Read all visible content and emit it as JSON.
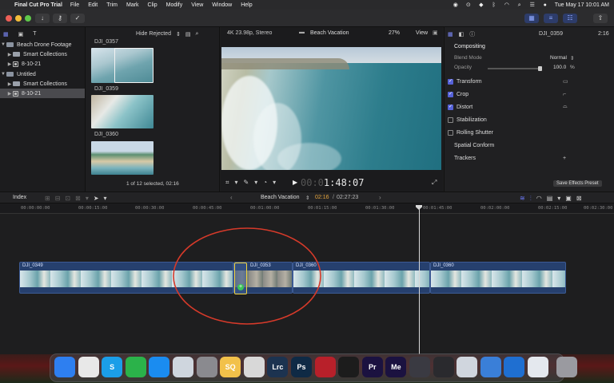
{
  "menubar": {
    "app_name": "Final Cut Pro Trial",
    "items": [
      "File",
      "Edit",
      "Trim",
      "Mark",
      "Clip",
      "Modify",
      "View",
      "Window",
      "Help"
    ],
    "datetime": "Tue May 17  10:01 AM"
  },
  "browser": {
    "filter_label": "Hide Rejected",
    "libraries": [
      {
        "label": "Beach Drone Footage",
        "type": "library"
      },
      {
        "label": "Smart Collections",
        "type": "folder"
      },
      {
        "label": "8-10-21",
        "type": "event"
      },
      {
        "label": "Untitled",
        "type": "library"
      },
      {
        "label": "Smart Collections",
        "type": "folder"
      },
      {
        "label": "8-10-21",
        "type": "event"
      }
    ],
    "clips": [
      {
        "name": "DJI_0357"
      },
      {
        "name": "DJI_0359"
      },
      {
        "name": "DJI_0360"
      }
    ],
    "selection_status": "1 of 12 selected, 02:16"
  },
  "viewer": {
    "format": "4K 23.98p, Stereo",
    "project_name": "Beach Vacation",
    "zoom": "27%",
    "view_menu": "View",
    "timecode": "00:01:48:07",
    "timecode_dim": "00:0",
    "timecode_bright": "1:48:07"
  },
  "inspector": {
    "clip_name": "DJI_0359",
    "duration": "2:16",
    "section_compositing": "Compositing",
    "blend_mode_label": "Blend Mode",
    "blend_mode_value": "Normal",
    "opacity_label": "Opacity",
    "opacity_value": "100.0",
    "opacity_unit": "%",
    "rows": [
      {
        "label": "Transform",
        "checked": true
      },
      {
        "label": "Crop",
        "checked": true
      },
      {
        "label": "Distort",
        "checked": true
      },
      {
        "label": "Stabilization",
        "checked": false
      },
      {
        "label": "Rolling Shutter",
        "checked": false
      },
      {
        "label": "Spatial Conform",
        "checked": null
      },
      {
        "label": "Trackers",
        "checked": null
      }
    ],
    "save_preset_label": "Save Effects Preset"
  },
  "timeline": {
    "index_label": "Index",
    "project_name": "Beach Vacation",
    "position": "02:16",
    "total": "02:27:23",
    "ruler_ticks": [
      "00:00:00:00",
      "00:00:15:00",
      "00:00:30:00",
      "00:00:45:00",
      "00:01:00:00",
      "00:01:15:00",
      "00:01:30:00",
      "00:01:45:00",
      "00:02:00:00",
      "00:02:15:00",
      "00:02:30:00"
    ],
    "clips": [
      {
        "name": "DJI_0349"
      },
      {
        "name": "DJI_0353"
      },
      {
        "name": "DJI_0360"
      },
      {
        "name": "DJI_0360"
      }
    ]
  },
  "dock": {
    "apps": [
      {
        "name": "Finder",
        "icon": "finder-icon",
        "label": "",
        "color": "#2e7ff0"
      },
      {
        "name": "Chrome",
        "icon": "chrome-icon",
        "label": "",
        "color": "#e8e8e8"
      },
      {
        "name": "Skype",
        "icon": "skype-icon",
        "label": "S",
        "color": "#1b9ee8"
      },
      {
        "name": "FaceTime",
        "icon": "facetime-icon",
        "label": "",
        "color": "#2bb24a"
      },
      {
        "name": "App Store",
        "icon": "app-store-icon",
        "label": "",
        "color": "#1a8cf0"
      },
      {
        "name": "Preview",
        "icon": "preview-icon",
        "label": "",
        "color": "#cfd6de"
      },
      {
        "name": "System Preferences",
        "icon": "settings-icon",
        "label": "",
        "color": "#8a8a8f"
      },
      {
        "name": "SQ",
        "icon": "sq-icon",
        "label": "SQ",
        "color": "#f2c14a"
      },
      {
        "name": "Darkroom",
        "icon": "darkroom-icon",
        "label": "",
        "color": "#d8d8d8"
      },
      {
        "name": "Lightroom Classic",
        "icon": "lightroom-icon",
        "label": "Lrc",
        "color": "#1c3350"
      },
      {
        "name": "Photoshop",
        "icon": "photoshop-icon",
        "label": "Ps",
        "color": "#0f2a45"
      },
      {
        "name": "Photo Booth",
        "icon": "photo-booth-icon",
        "label": "",
        "color": "#b8202a"
      },
      {
        "name": "Spotify",
        "icon": "spotify-icon",
        "label": "",
        "color": "#1c1c1c"
      },
      {
        "name": "Premiere Pro",
        "icon": "premiere-icon",
        "label": "Pr",
        "color": "#1b1240"
      },
      {
        "name": "Media Encoder",
        "icon": "media-encoder-icon",
        "label": "Me",
        "color": "#1b1240"
      },
      {
        "name": "QuickTime",
        "icon": "quicktime-icon",
        "label": "",
        "color": "#3a3a42"
      },
      {
        "name": "Final Cut Pro",
        "icon": "final-cut-icon",
        "label": "",
        "color": "#2a2a2e"
      },
      {
        "name": "AirDrop",
        "icon": "airdrop-icon",
        "label": "",
        "color": "#d0d6de"
      },
      {
        "name": "Screenshot",
        "icon": "screenshot-icon",
        "label": "",
        "color": "#3a7fd8"
      },
      {
        "name": "Prime Video",
        "icon": "prime-video-icon",
        "label": "",
        "color": "#1f6fd1"
      },
      {
        "name": "Cloud",
        "icon": "cloud-icon",
        "label": "",
        "color": "#e4e8ee"
      },
      {
        "name": "Trash",
        "icon": "trash-icon",
        "label": "",
        "color": "#9a9aa0"
      }
    ]
  },
  "colors": {
    "accent": "#5662d8",
    "timeline_clip": "#26406e",
    "highlight_ring": "#d63a2a",
    "trim_handle": "#f1d33c"
  }
}
